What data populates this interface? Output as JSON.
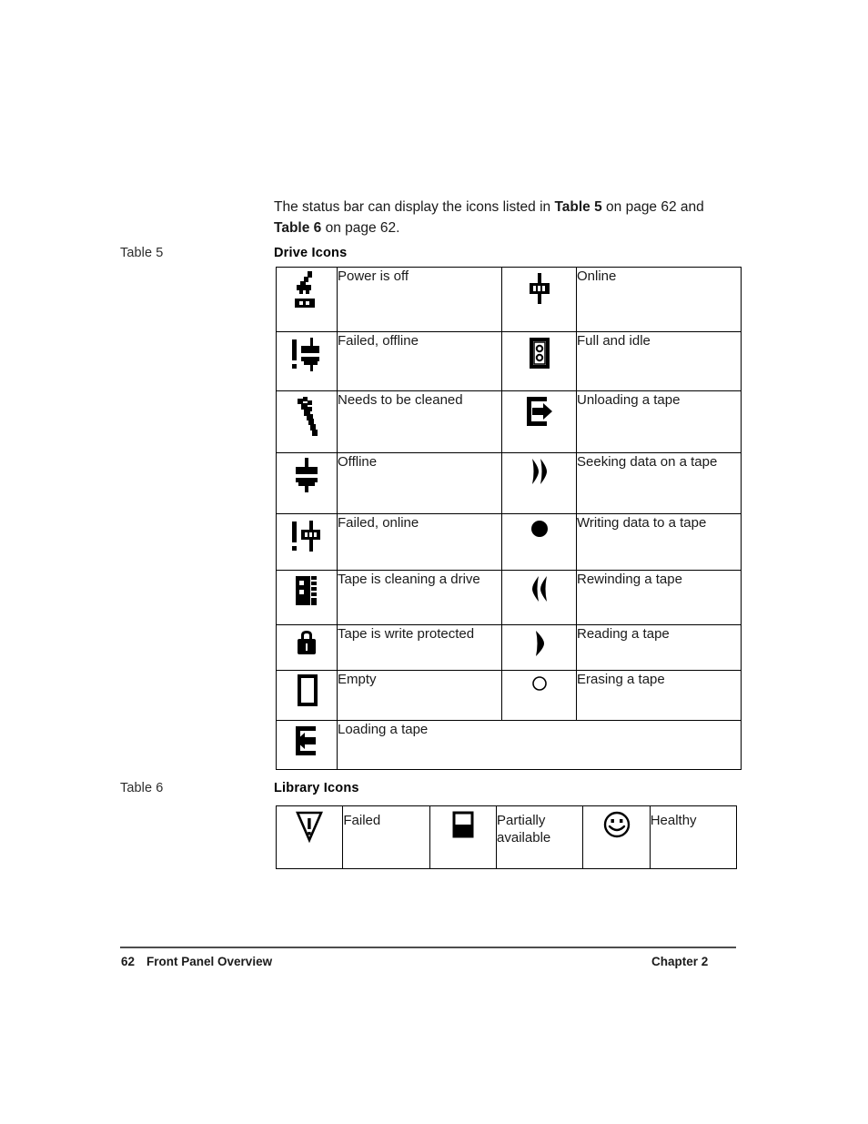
{
  "intro": {
    "part1": "The status bar can display the icons listed in ",
    "ref1": "Table 5",
    "part2": " on page 62 and ",
    "ref2": "Table 6",
    "part3": " on page 62."
  },
  "table5": {
    "margin_label": "Table 5",
    "title": "Drive Icons",
    "rows": [
      {
        "icon_left": "power-off-icon",
        "label_left": "Power is off",
        "icon_right": "online-icon",
        "label_right": "Online"
      },
      {
        "icon_left": "failed-offline-icon",
        "label_left": "Failed, offline",
        "icon_right": "full-and-idle-icon",
        "label_right": "Full and idle"
      },
      {
        "icon_left": "needs-cleaning-icon",
        "label_left": "Needs to be cleaned",
        "icon_right": "unloading-tape-icon",
        "label_right": "Unloading a tape"
      },
      {
        "icon_left": "offline-icon",
        "label_left": "Offline",
        "icon_right": "seeking-icon",
        "label_right": "Seeking data on a tape"
      },
      {
        "icon_left": "failed-online-icon",
        "label_left": "Failed, online",
        "icon_right": "writing-icon",
        "label_right": "Writing data to a tape"
      },
      {
        "icon_left": "cleaning-tape-icon",
        "label_left": "Tape is cleaning a drive",
        "icon_right": "rewinding-icon",
        "label_right": "Rewinding a tape"
      },
      {
        "icon_left": "write-protected-icon",
        "label_left": "Tape is write protected",
        "icon_right": "reading-icon",
        "label_right": "Reading a tape"
      },
      {
        "icon_left": "empty-icon",
        "label_left": "Empty",
        "icon_right": "erasing-icon",
        "label_right": "Erasing a tape"
      }
    ],
    "last_row": {
      "icon": "loading-tape-icon",
      "label": "Loading a tape"
    }
  },
  "table6": {
    "margin_label": "Table 6",
    "title": "Library Icons",
    "cells": [
      {
        "icon": "failed-warning-icon",
        "label": "Failed"
      },
      {
        "icon": "partially-available-icon",
        "label": "Partially available"
      },
      {
        "icon": "healthy-smiley-icon",
        "label": "Healthy"
      }
    ]
  },
  "footer": {
    "page_number": "62",
    "section": "Front Panel Overview",
    "chapter": "Chapter 2"
  },
  "colors": {
    "text": "#1a1a1a",
    "rule": "#4d4d4d",
    "border": "#000000"
  }
}
